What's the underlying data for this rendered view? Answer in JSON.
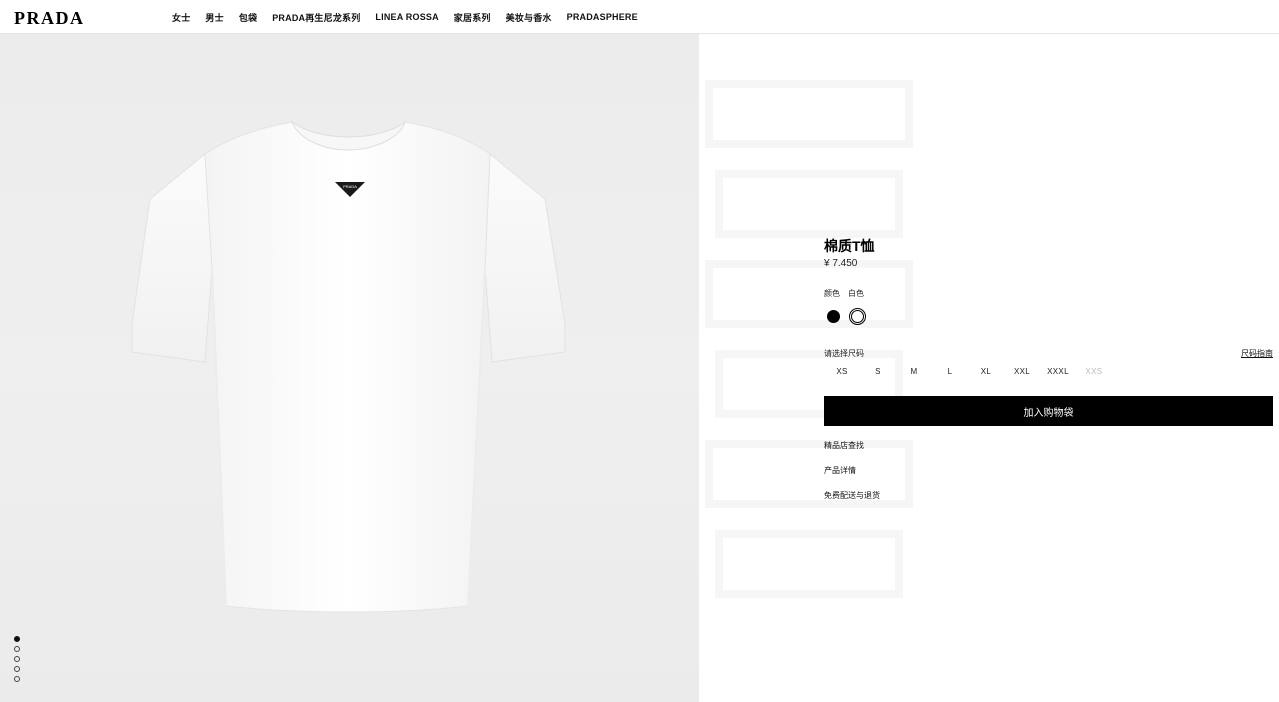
{
  "header": {
    "logo": "PRADA",
    "nav": [
      "女士",
      "男士",
      "包袋",
      "PRADA再生尼龙系列",
      "LINEA ROSSA",
      "家居系列",
      "美妆与香水",
      "PRADASPHERE"
    ]
  },
  "product": {
    "title": "棉质T恤",
    "price": "¥ 7.450",
    "color_label": "颜色",
    "color_value": "白色",
    "swatches": [
      {
        "name": "black",
        "color": "#000000",
        "selected": false
      },
      {
        "name": "white",
        "color": "#ffffff",
        "selected": true
      }
    ],
    "size_label": "请选择尺码",
    "size_guide": "尺码指南",
    "sizes": [
      {
        "label": "XS",
        "available": true
      },
      {
        "label": "S",
        "available": true
      },
      {
        "label": "M",
        "available": true
      },
      {
        "label": "L",
        "available": true
      },
      {
        "label": "XL",
        "available": true
      },
      {
        "label": "XXL",
        "available": true
      },
      {
        "label": "XXXL",
        "available": true
      },
      {
        "label": "XXS",
        "available": false
      }
    ],
    "add_to_bag": "加入购物袋",
    "links": [
      "精品店查找",
      "产品详情",
      "免费配送与退货"
    ]
  },
  "gallery": {
    "image_count": 5,
    "active_index": 0,
    "tshirt_color": "#ffffff",
    "background_color": "#ececec"
  }
}
